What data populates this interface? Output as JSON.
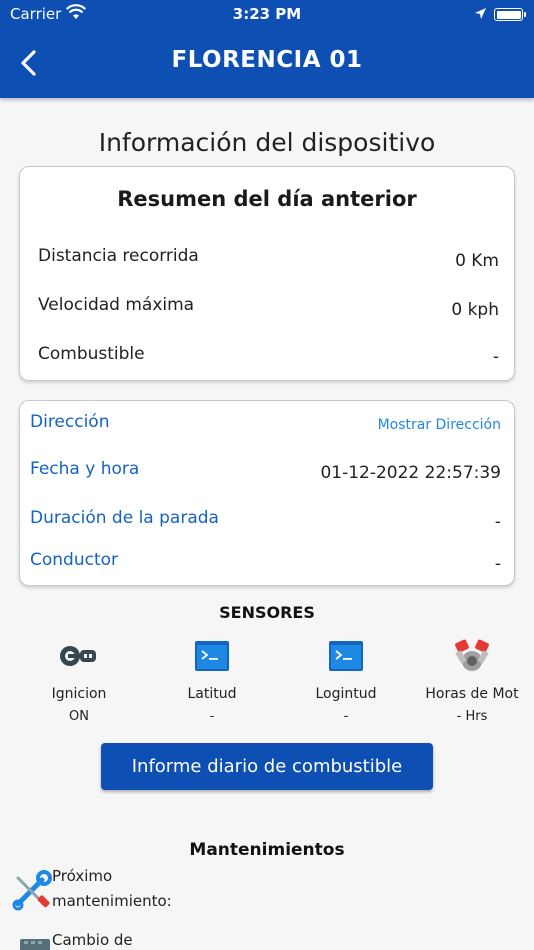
{
  "status": {
    "carrier": "Carrier",
    "time": "3:23 PM"
  },
  "header": {
    "title": "FLORENCIA 01"
  },
  "page": {
    "heading": "Información del dispositivo"
  },
  "summary": {
    "title": "Resumen del día anterior",
    "rows": [
      {
        "label": "Distancia recorrida",
        "value": "0 Km"
      },
      {
        "label": "Velocidad máxima",
        "value": "0 kph"
      },
      {
        "label": "Combustible",
        "value": "-"
      }
    ]
  },
  "details": {
    "direction": {
      "label": "Dirección",
      "action": "Mostrar Dirección"
    },
    "datetime": {
      "label": "Fecha y hora",
      "value": "01-12-2022 22:57:39"
    },
    "stop_duration": {
      "label": "Duración de la parada",
      "value": "-"
    },
    "driver": {
      "label": "Conductor",
      "value": "-"
    }
  },
  "sensors": {
    "title": "SENSORES",
    "items": [
      {
        "label": "Ignicion",
        "value": "ON",
        "icon": "ignition-key-icon"
      },
      {
        "label": "Latitud",
        "value": "-",
        "icon": "terminal-icon"
      },
      {
        "label": "Logintud",
        "value": "-",
        "icon": "terminal-icon"
      },
      {
        "label": "Horas de Mot",
        "value": "- Hrs",
        "icon": "engine-icon"
      }
    ]
  },
  "fuel_report": {
    "label": "Informe diario de combustible"
  },
  "maintenance": {
    "title": "Mantenimientos",
    "next_line1": "Próximo",
    "next_line2": "mantenimiento:",
    "change_line1": "Cambio de"
  },
  "colors": {
    "primary": "#0d4fb3",
    "link": "#1e88e5",
    "label_blue": "#1563c0"
  }
}
